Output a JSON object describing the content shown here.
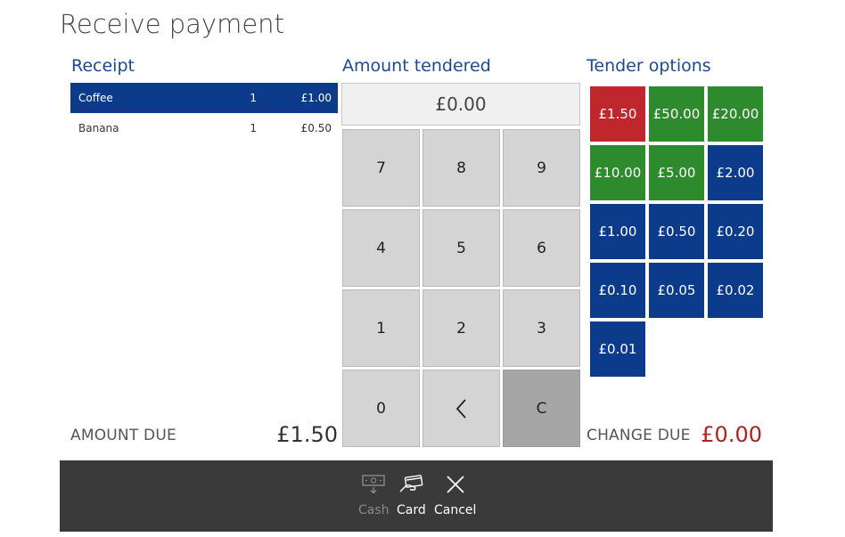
{
  "title": "Receive payment",
  "receipt": {
    "heading": "Receipt",
    "items": [
      {
        "name": "Coffee",
        "qty": "1",
        "price": "£1.00"
      },
      {
        "name": "Banana",
        "qty": "1",
        "price": "£0.50"
      }
    ]
  },
  "amount": {
    "heading": "Amount tendered",
    "display": "£0.00",
    "keys": [
      "7",
      "8",
      "9",
      "4",
      "5",
      "6",
      "1",
      "2",
      "3",
      "0"
    ],
    "clear_label": "C"
  },
  "tender": {
    "heading": "Tender options",
    "options": [
      {
        "label": "£1.50",
        "color": "#c0272d"
      },
      {
        "label": "£50.00",
        "color": "#2d8a2d"
      },
      {
        "label": "£20.00",
        "color": "#2d8a2d"
      },
      {
        "label": "£10.00",
        "color": "#2d8a2d"
      },
      {
        "label": "£5.00",
        "color": "#2d8a2d"
      },
      {
        "label": "£2.00",
        "color": "#0d3b8c"
      },
      {
        "label": "£1.00",
        "color": "#0d3b8c"
      },
      {
        "label": "£0.50",
        "color": "#0d3b8c"
      },
      {
        "label": "£0.20",
        "color": "#0d3b8c"
      },
      {
        "label": "£0.10",
        "color": "#0d3b8c"
      },
      {
        "label": "£0.05",
        "color": "#0d3b8c"
      },
      {
        "label": "£0.02",
        "color": "#0d3b8c"
      },
      {
        "label": "£0.01",
        "color": "#0d3b8c"
      }
    ]
  },
  "totals": {
    "amount_due_label": "AMOUNT DUE",
    "amount_due_value": "£1.50",
    "change_due_label": "CHANGE DUE",
    "change_due_value": "£0.00",
    "change_color": "#b02222"
  },
  "actions": {
    "cash": {
      "label": "Cash",
      "icon": "cash-icon",
      "enabled": false
    },
    "card": {
      "label": "Card",
      "icon": "card-icon",
      "enabled": true
    },
    "cancel": {
      "label": "Cancel",
      "icon": "close-icon",
      "enabled": true
    }
  },
  "colors": {
    "accent": "#1c4a92",
    "selected_row": "#0d3b8c",
    "bar": "#3a3a3a"
  }
}
